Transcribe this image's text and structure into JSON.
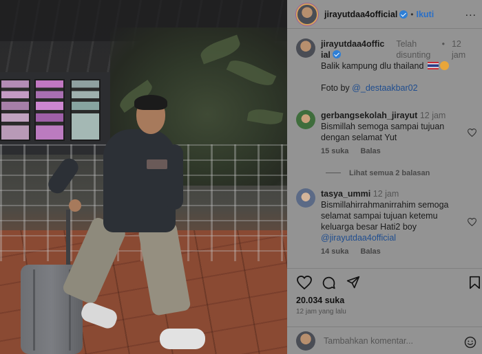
{
  "header": {
    "username": "jirayutdaa4official",
    "separator": "•",
    "follow_label": "Ikuti",
    "more_label": "..."
  },
  "caption": {
    "username": "jirayutdaa4offic ial",
    "edited_label": "Telah disunting",
    "separator": "•",
    "age": "12 jam",
    "text": "Balik kampung dlu thailand",
    "photo_credit_prefix": "Foto by",
    "photo_credit_mention": "@_destaakbar02"
  },
  "comments": [
    {
      "username": "gerbangsekolah_jirayut",
      "age": "12 jam",
      "text": "Bismillah semoga sampai tujuan dengan selamat Yut",
      "likes": "15 suka",
      "reply_label": "Balas",
      "avatar_color": "#3f6d3c"
    },
    {
      "username": "tasya_ummi",
      "age": "12 jam",
      "text": "Bismillahirrahmanirrahim semoga selamat sampai tujuan ketemu keluarga besar Hati2 boy",
      "mention": "@jirayutdaa4official",
      "likes": "14 suka",
      "reply_label": "Balas",
      "avatar_color": "#5b6a86"
    }
  ],
  "view_replies_label": "Lihat semua 2 balasan",
  "actions": {
    "like_icon": "heart-icon",
    "comment_icon": "comment-icon",
    "share_icon": "send-icon",
    "save_icon": "bookmark-icon"
  },
  "likes_count": "20.034 suka",
  "post_time": "12 jam yang lalu",
  "add_comment": {
    "placeholder": "Tambahkan komentar..."
  },
  "colors": {
    "link": "#2a6fc7",
    "verified": "#2e7fd6",
    "overlay_gray": "#939393"
  }
}
